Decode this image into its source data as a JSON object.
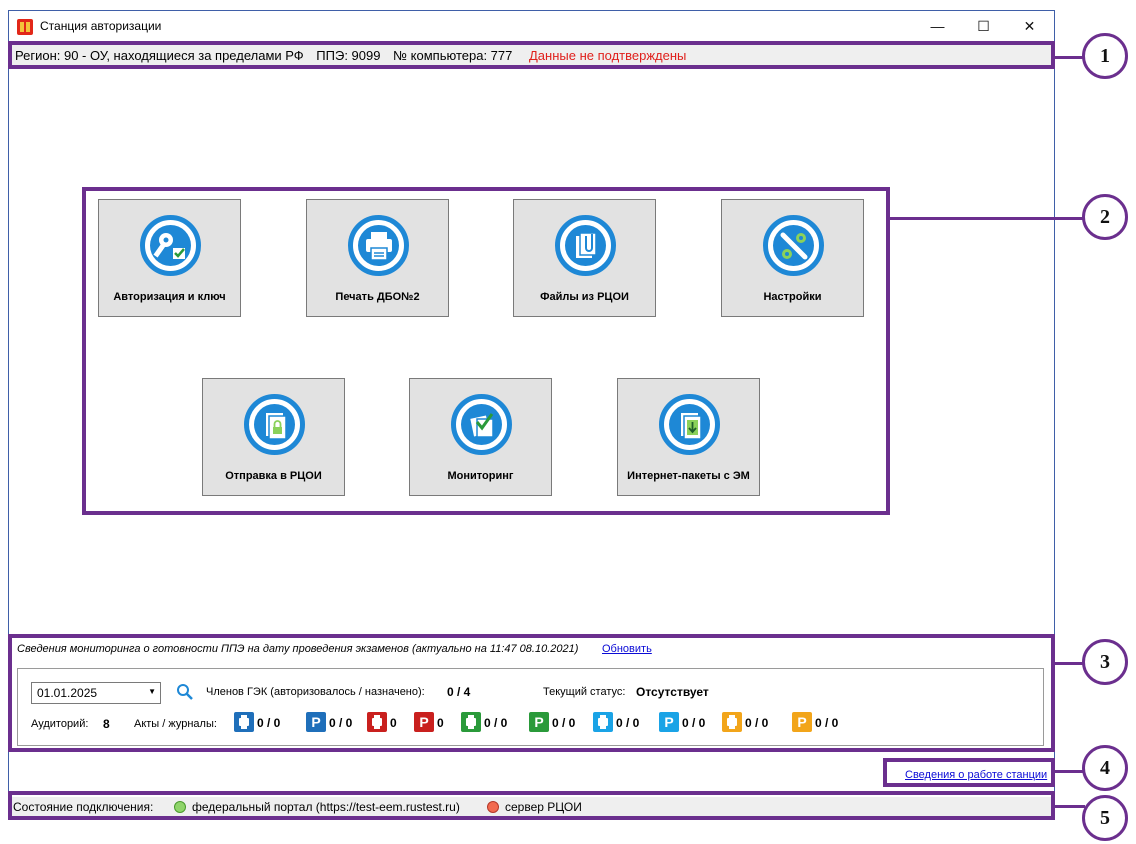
{
  "window": {
    "title": "Станция авторизации",
    "controls": {
      "minimize": "—",
      "maximize": "☐",
      "close": "✕"
    }
  },
  "infobar": {
    "region": "Регион: 90 - ОУ, находящиеся за пределами РФ",
    "ppe": "ППЭ: 9099",
    "computer": "№ компьютера: 777",
    "warning": "Данные не подтверждены"
  },
  "main_buttons": [
    {
      "label": "Авторизация и ключ",
      "icon": "key-check-icon"
    },
    {
      "label": "Печать ДБО№2",
      "icon": "printer-icon"
    },
    {
      "label": "Файлы из РЦОИ",
      "icon": "files-clip-icon"
    },
    {
      "label": "Настройки",
      "icon": "wrench-gear-icon"
    },
    {
      "label": "Отправка в РЦОИ",
      "icon": "lock-document-icon"
    },
    {
      "label": "Мониторинг",
      "icon": "checklist-icon"
    },
    {
      "label": "Интернет-пакеты с ЭМ",
      "icon": "download-document-icon"
    }
  ],
  "monitoring": {
    "header": "Сведения мониторинга о готовности ППЭ на дату проведения экзаменов (актуально на 11:47 08.10.2021)",
    "refresh": "Обновить",
    "date": "01.01.2025",
    "gek_label": "Членов ГЭК (авторизовалось / назначено):",
    "gek_value": "0 / 4",
    "status_label": "Текущий статус:",
    "status_value": "Отсутствует",
    "auditories_label": "Аудиторий:",
    "auditories_value": "8",
    "acts_label": "Акты / журналы:",
    "acts": [
      {
        "icon": "printer-icon",
        "color": "#1f6fba",
        "value": "0 / 0"
      },
      {
        "icon": "letter-p-icon",
        "text": "P",
        "color": "#1f6fba",
        "value": "0 / 0"
      },
      {
        "icon": "scanner-icon",
        "color": "#c9201e",
        "value": "0"
      },
      {
        "icon": "letter-p-icon",
        "text": "P",
        "color": "#c9201e",
        "value": "0"
      },
      {
        "icon": "scanner-icon",
        "color": "#2a9a3a",
        "value": "0 / 0"
      },
      {
        "icon": "letter-p-icon",
        "text": "P",
        "color": "#2a9a3a",
        "value": "0 / 0"
      },
      {
        "icon": "headset-icon",
        "color": "#1aa3e6",
        "value": "0 / 0"
      },
      {
        "icon": "letter-p-icon",
        "text": "P",
        "color": "#1aa3e6",
        "value": "0 / 0"
      },
      {
        "icon": "board-icon",
        "color": "#f2a51a",
        "value": "0 / 0"
      },
      {
        "icon": "letter-p-icon",
        "text": "P",
        "color": "#f2a51a",
        "value": "0 / 0"
      }
    ]
  },
  "station_link": "Сведения о работе станции",
  "statusbar": {
    "label": "Состояние подключения:",
    "federal": "федеральный портал (https://test-eem.rustest.ru)",
    "federal_color": "#8fd46a",
    "rcoi": "сервер РЦОИ",
    "rcoi_color": "#f26a4f"
  },
  "callouts": [
    "1",
    "2",
    "3",
    "4",
    "5"
  ]
}
